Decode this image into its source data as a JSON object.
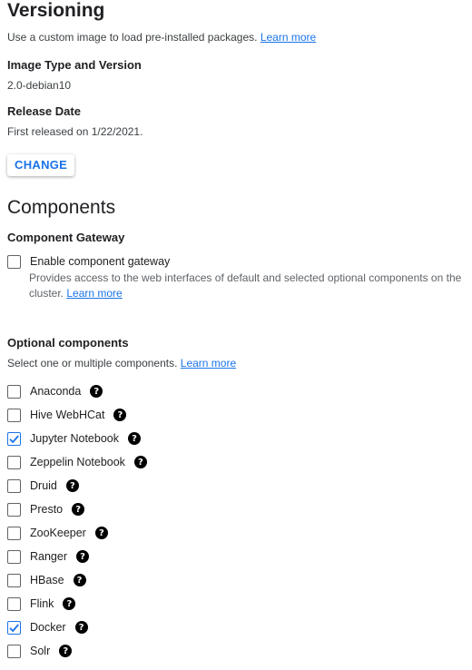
{
  "versioning": {
    "title": "Versioning",
    "description": "Use a custom image to load pre-installed packages.",
    "learn_more": "Learn more",
    "image_type_label": "Image Type and Version",
    "image_type_value": "2.0-debian10",
    "release_date_label": "Release Date",
    "release_date_value": "First released on 1/22/2021.",
    "change_button": "CHANGE"
  },
  "components": {
    "title": "Components",
    "gateway_label": "Component Gateway",
    "gateway_checkbox_label": "Enable component gateway",
    "gateway_checked": false,
    "gateway_description_line1": "Provides access to the web interfaces of default and selected optional components on the",
    "gateway_description_line2": "cluster.",
    "gateway_learn_more": "Learn more",
    "optional_label": "Optional components",
    "optional_description": "Select one or multiple components.",
    "optional_learn_more": "Learn more",
    "items": [
      {
        "label": "Anaconda",
        "checked": false
      },
      {
        "label": "Hive WebHCat",
        "checked": false
      },
      {
        "label": "Jupyter Notebook",
        "checked": true
      },
      {
        "label": "Zeppelin Notebook",
        "checked": false
      },
      {
        "label": "Druid",
        "checked": false
      },
      {
        "label": "Presto",
        "checked": false
      },
      {
        "label": "ZooKeeper",
        "checked": false
      },
      {
        "label": "Ranger",
        "checked": false
      },
      {
        "label": "HBase",
        "checked": false
      },
      {
        "label": "Flink",
        "checked": false
      },
      {
        "label": "Docker",
        "checked": true
      },
      {
        "label": "Solr",
        "checked": false
      }
    ],
    "help_icon_glyph": "?"
  },
  "colors": {
    "accent": "#1a73e8"
  }
}
